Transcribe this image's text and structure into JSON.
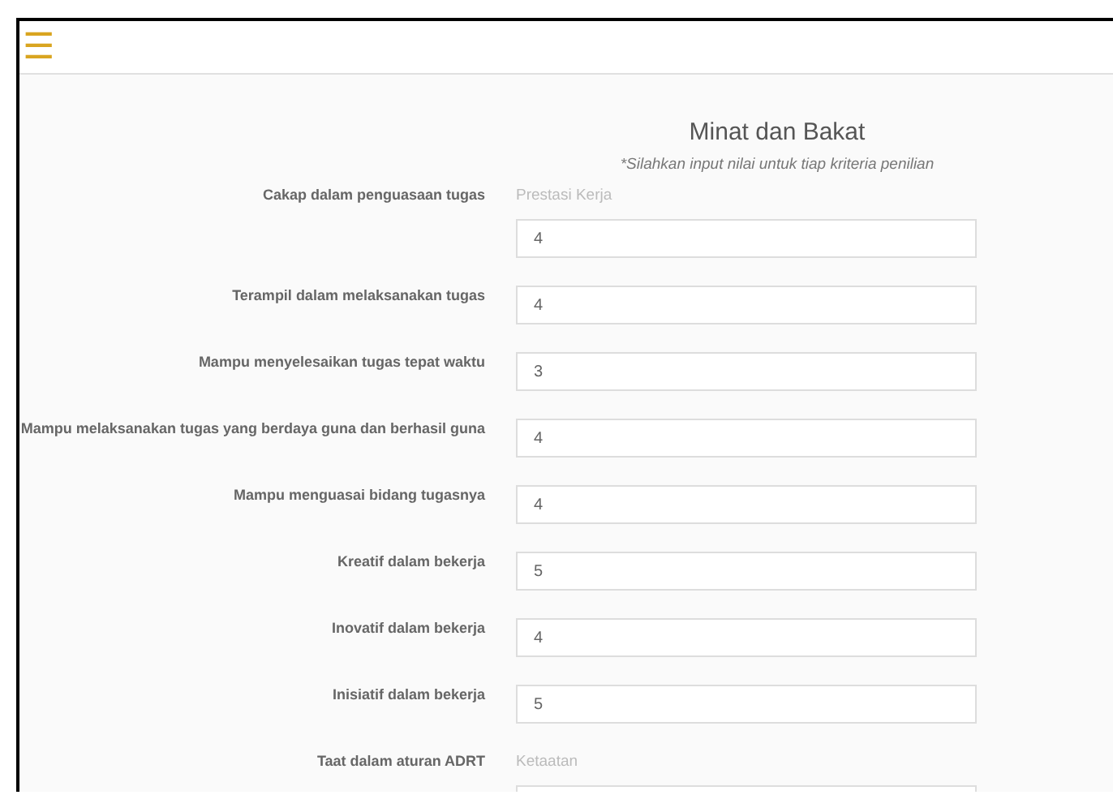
{
  "header": {
    "menu": "☰"
  },
  "form": {
    "title": "Minat dan Bakat",
    "subtitle": "*Silahkan input nilai untuk tiap kriteria penilian",
    "rows": [
      {
        "label": "Cakap dalam penguasaan tugas",
        "group": "Prestasi Kerja",
        "value": "4"
      },
      {
        "label": "Terampil dalam melaksanakan tugas",
        "value": "4"
      },
      {
        "label": "Mampu menyelesaikan tugas tepat waktu",
        "value": "3"
      },
      {
        "label": "Mampu melaksanakan tugas yang berdaya guna dan berhasil guna",
        "value": "4"
      },
      {
        "label": "Mampu menguasai bidang tugasnya",
        "value": "4"
      },
      {
        "label": "Kreatif dalam bekerja",
        "value": "5"
      },
      {
        "label": "Inovatif dalam bekerja",
        "value": "4"
      },
      {
        "label": "Inisiatif dalam bekerja",
        "value": "5"
      },
      {
        "label": "Taat dalam aturan ADRT",
        "group": "Ketaatan"
      }
    ]
  }
}
